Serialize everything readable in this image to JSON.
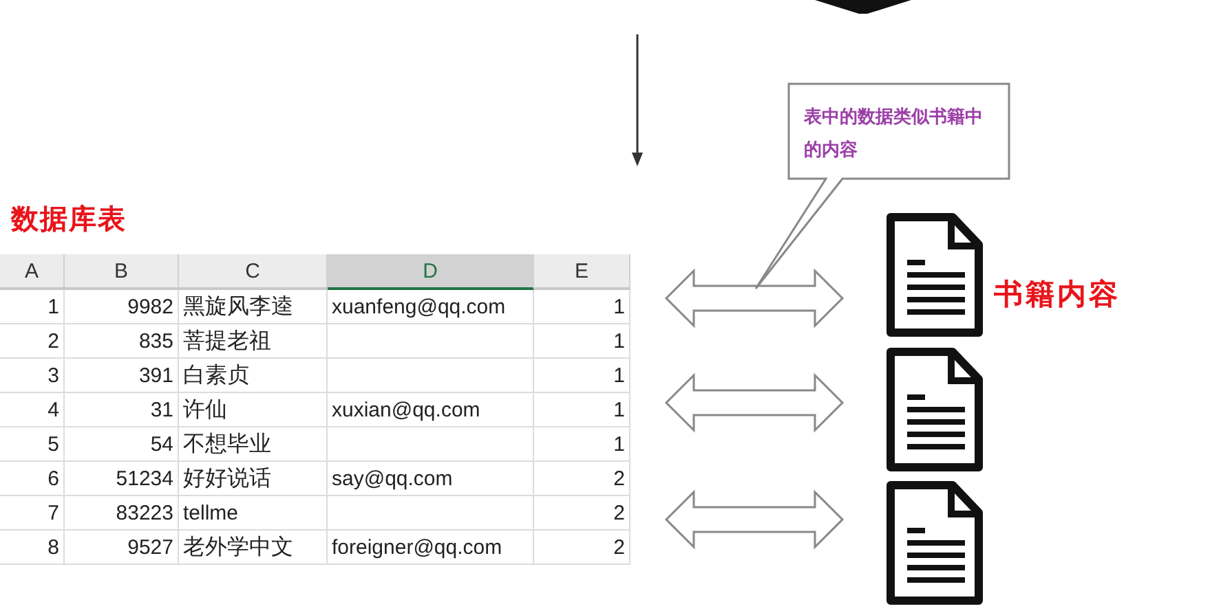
{
  "table_title": "数据库表",
  "table": {
    "columns": [
      {
        "label": "A",
        "selected": false
      },
      {
        "label": "B",
        "selected": false
      },
      {
        "label": "C",
        "selected": false
      },
      {
        "label": "D",
        "selected": true
      },
      {
        "label": "E",
        "selected": false
      }
    ],
    "rows": [
      [
        "1",
        "9982",
        "黑旋风李逵",
        "xuanfeng@qq.com",
        "1"
      ],
      [
        "2",
        "835",
        "菩提老祖",
        "",
        "1"
      ],
      [
        "3",
        "391",
        "白素贞",
        "",
        "1"
      ],
      [
        "4",
        "31",
        "许仙",
        "xuxian@qq.com",
        "1"
      ],
      [
        "5",
        "54",
        "不想毕业",
        "",
        "1"
      ],
      [
        "6",
        "51234",
        "好好说话",
        "say@qq.com",
        "2"
      ],
      [
        "7",
        "83223",
        "tellme",
        "",
        "2"
      ],
      [
        "8",
        "9527",
        "老外学中文",
        "foreigner@qq.com",
        "2"
      ]
    ]
  },
  "callout": "表中的数据类似书籍中的内容",
  "book_label": "书籍内容"
}
